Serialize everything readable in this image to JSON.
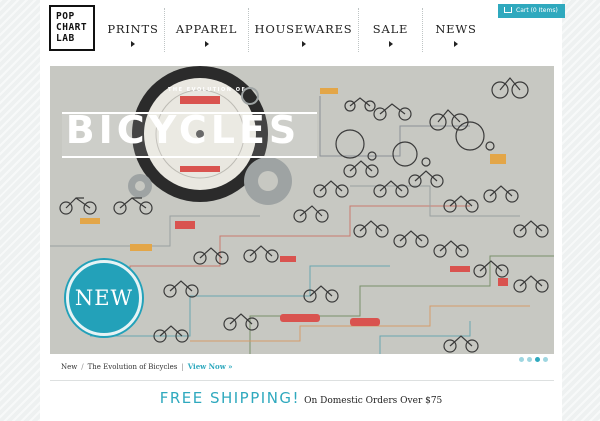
{
  "brand": {
    "logo_lines": [
      "POP",
      "CHART",
      "LAB"
    ]
  },
  "nav": {
    "items": [
      {
        "label": "PRINTS"
      },
      {
        "label": "APPAREL"
      },
      {
        "label": "HOUSEWARES"
      },
      {
        "label": "SALE"
      },
      {
        "label": "NEWS"
      }
    ]
  },
  "cart": {
    "label": "Cart (0 Items)"
  },
  "hero": {
    "headline": "BICYCLES",
    "small_title": "THE EVOLUTION OF",
    "badge": "NEW",
    "slides": 4,
    "active_slide": 3
  },
  "caption": {
    "category": "New",
    "title": "The Evolution of Bicycles",
    "link": "View Now »"
  },
  "shipping": {
    "headline": "FREE SHIPPING!",
    "subtext": "On Domestic Orders Over $75"
  },
  "colors": {
    "accent": "#2fa9be",
    "hero_bg": "#c7c8c2",
    "red": "#d9534f"
  }
}
